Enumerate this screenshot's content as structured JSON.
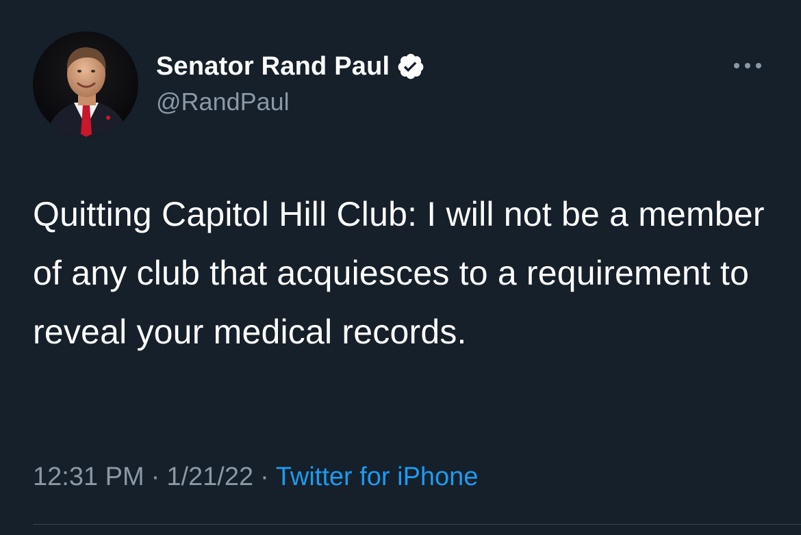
{
  "user": {
    "display_name": "Senator Rand Paul",
    "handle": "@RandPaul",
    "verified": true,
    "avatar_icon": "profile-photo"
  },
  "tweet": {
    "text": "Quitting Capitol Hill Club: I will not be a member of any club that acquiesces to a requirement to reveal your medical records.",
    "time": "12:31 PM",
    "date": "1/21/22",
    "separator": "·",
    "source": "Twitter for iPhone"
  },
  "icons": {
    "more": "more-horizontal-icon",
    "verified": "verified-badge-icon"
  },
  "colors": {
    "background": "#15202b",
    "text": "#ffffff",
    "secondary": "#8b98a5",
    "link": "#1d9bf0",
    "verified_badge": "#ffffff"
  }
}
